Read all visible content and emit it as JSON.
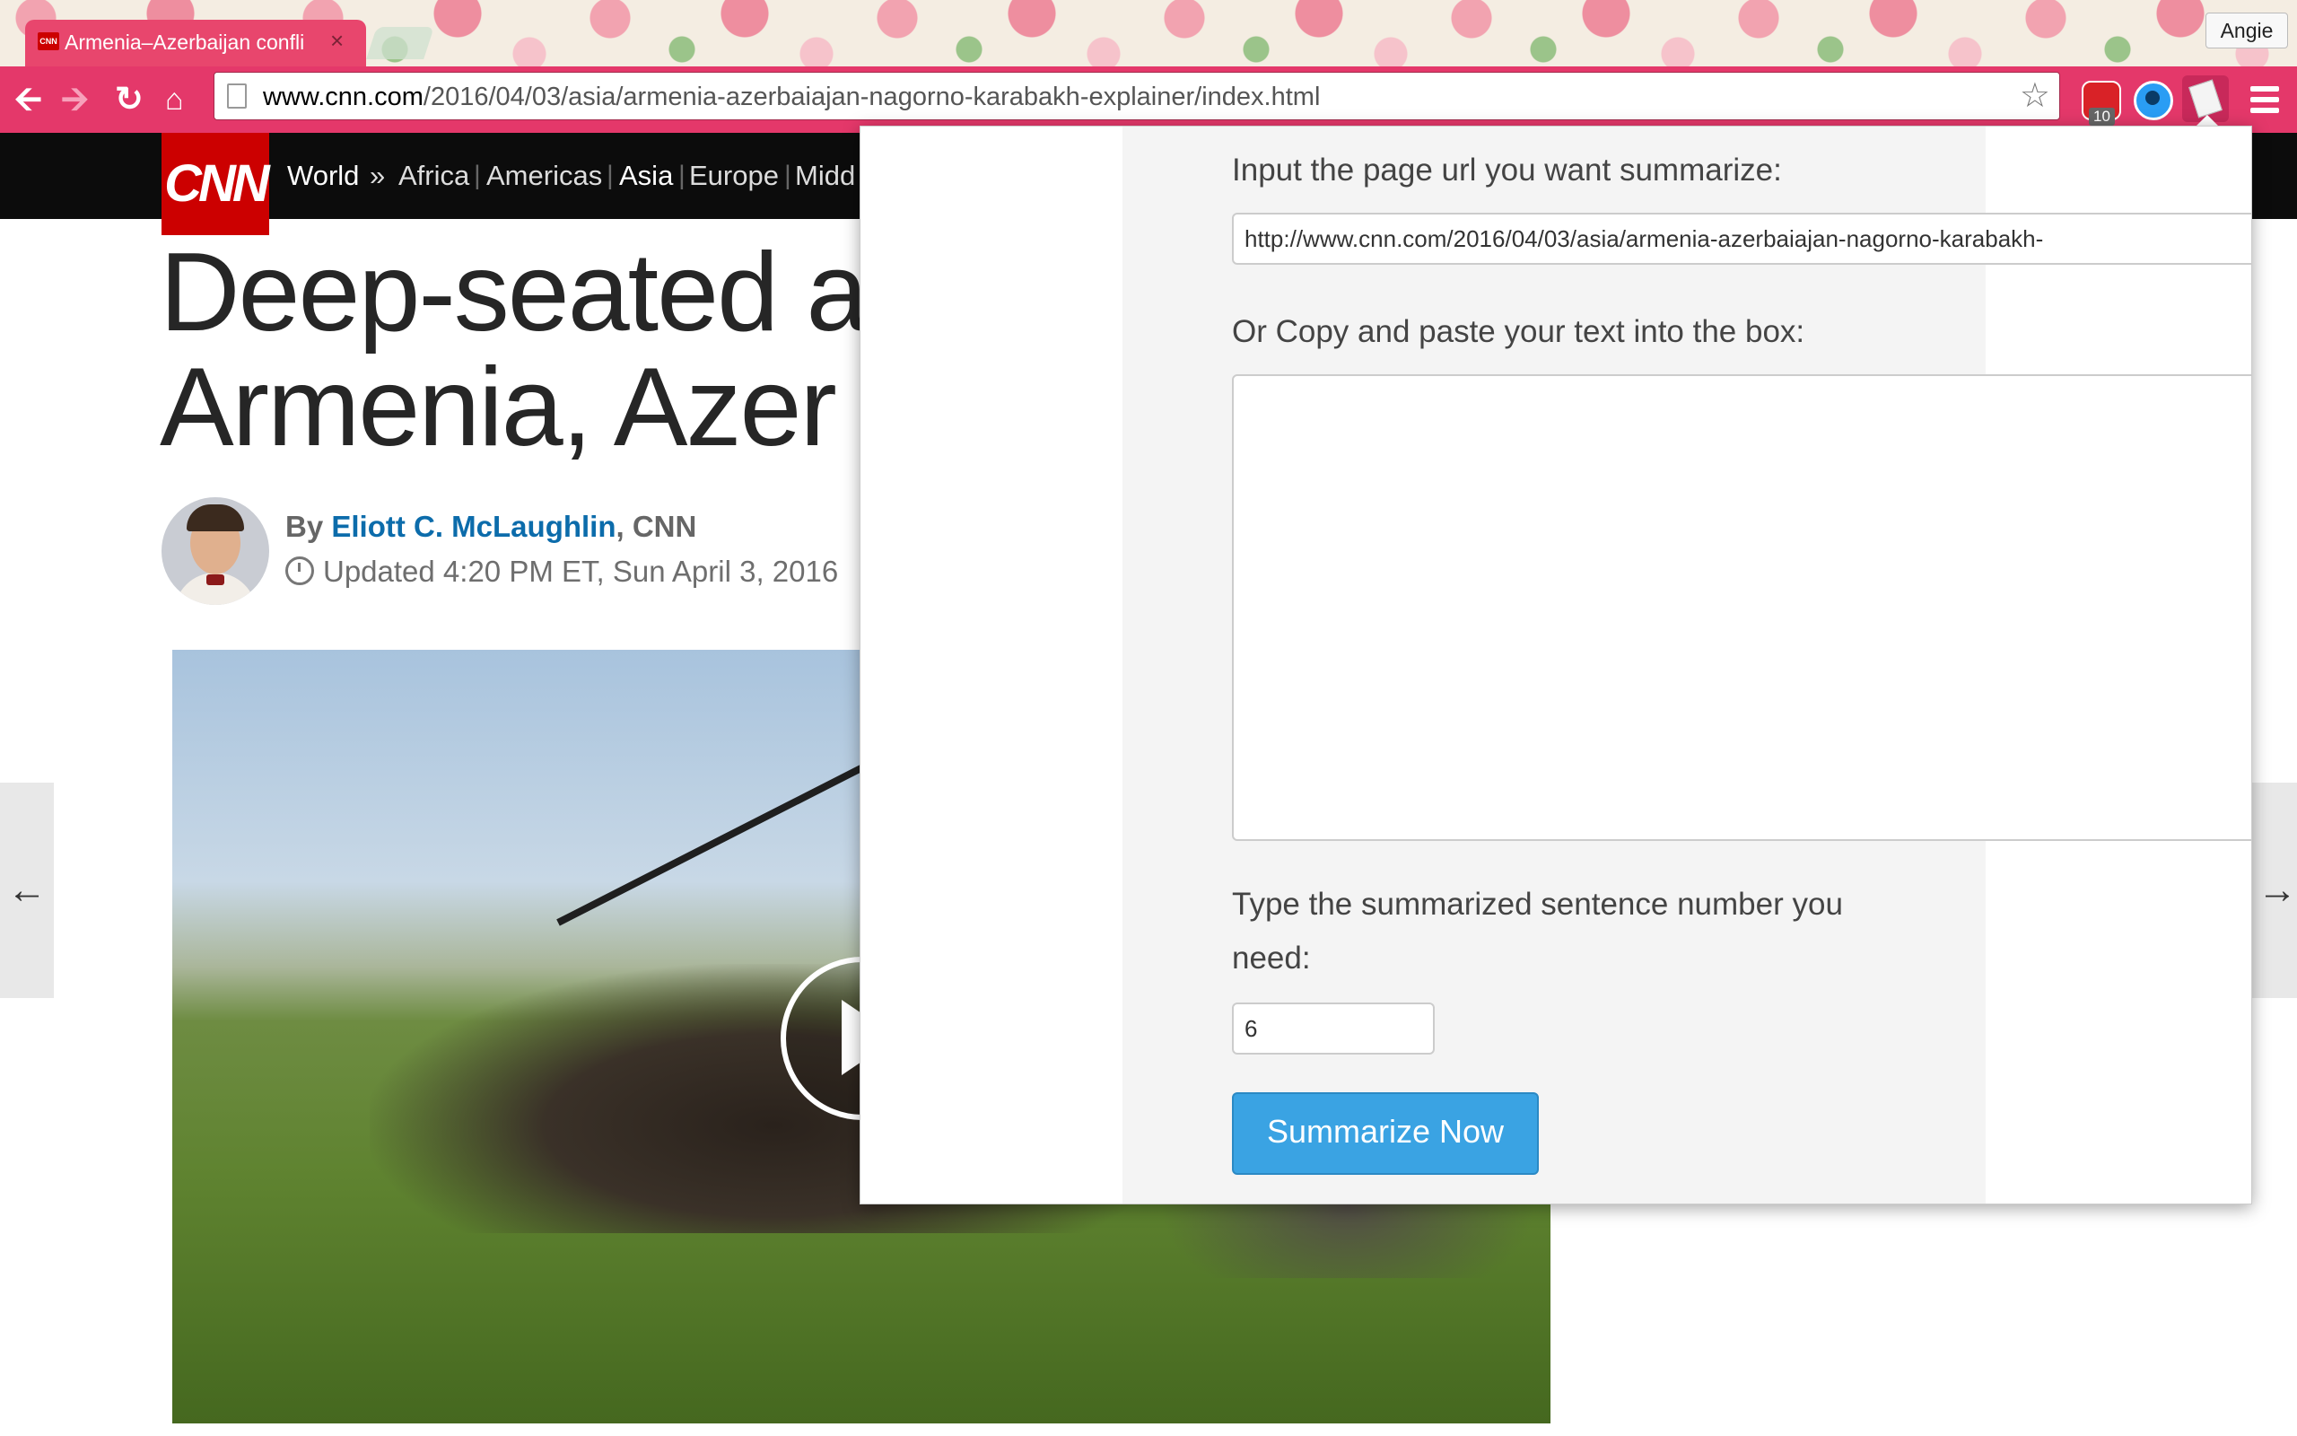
{
  "browser": {
    "tab_title": "Armenia–Azerbaijan confli",
    "tab_close": "×",
    "favicon_text": "CNN",
    "profile_name": "Angie",
    "url_host": "www.cnn.com",
    "url_path": "/2016/04/03/asia/armenia-azerbaiajan-nagorno-karabakh-explainer/index.html",
    "extension_badge": "10",
    "icons": [
      "back-arrow-icon",
      "forward-arrow-icon",
      "reload-icon",
      "home-icon",
      "page-icon",
      "bookmark-star-icon",
      "adblock-icon",
      "browser-extension-icon",
      "summarizer-extension-icon",
      "menu-icon"
    ]
  },
  "cnn": {
    "logo": "CNN",
    "nav": {
      "world": "World",
      "chevron": "»",
      "africa": "Africa",
      "americas": "Americas",
      "asia": "Asia",
      "europe": "Europe",
      "middle": "Midd"
    },
    "headline_line1": "Deep-seated a",
    "headline_line2": "Armenia, Azer",
    "byline_prefix": "By",
    "author": "Eliott C. McLaughlin",
    "byline_suffix": ", CNN",
    "updated": "Updated 4:20 PM ET, Sun April 3, 2016",
    "arrow_left": "🠔",
    "arrow_right": "🠖"
  },
  "popup": {
    "url_label": "Input the page url you want summarize:",
    "url_value": "http://www.cnn.com/2016/04/03/asia/armenia-azerbaiajan-nagorno-karabakh-",
    "text_label": "Or Copy and paste your text into the box:",
    "text_value": "",
    "number_label_line1": "Type the summarized sentence number you",
    "number_label_line2": "need:",
    "number_value": "6",
    "button_label": "Summarize Now"
  },
  "colors": {
    "toolbar": "#e4386a",
    "cnn_red": "#cc0000",
    "button_blue": "#3aa3e3",
    "author_link": "#0c6cab"
  }
}
